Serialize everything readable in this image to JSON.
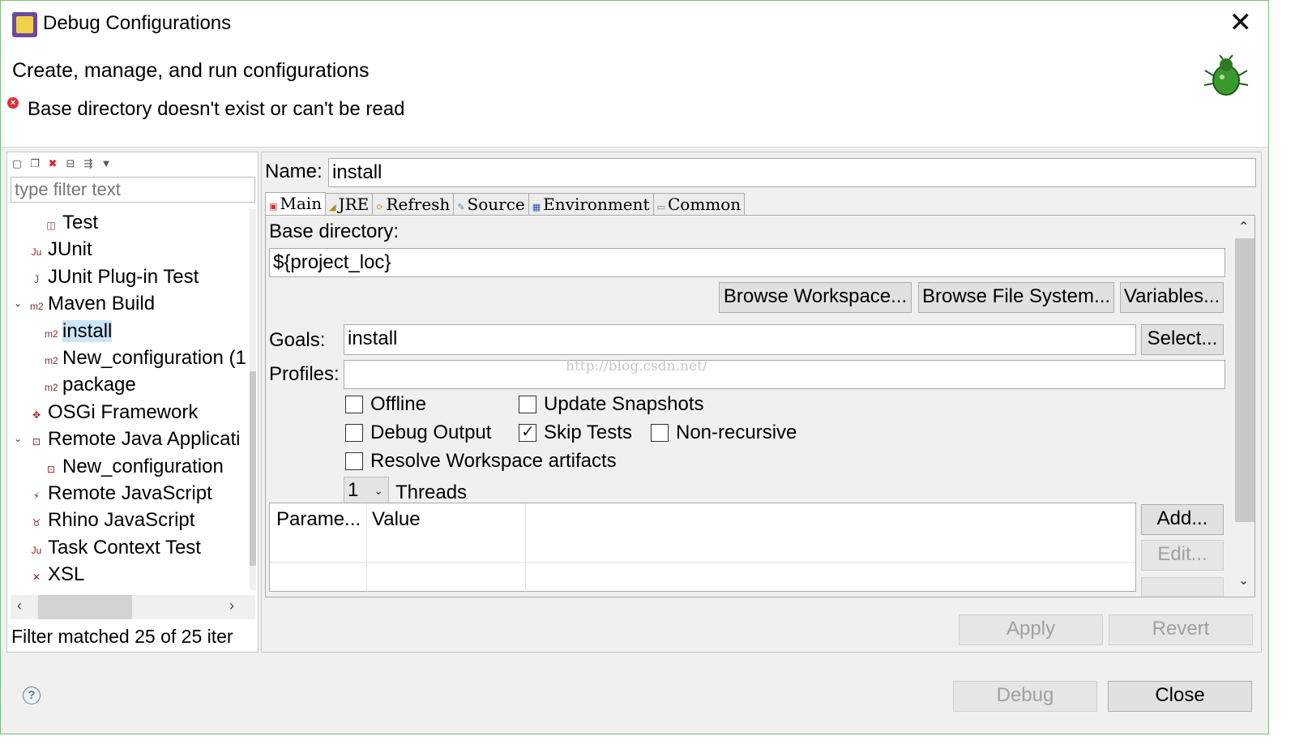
{
  "window": {
    "title": "Debug Configurations",
    "close_glyph": "✕"
  },
  "header": {
    "title": "Create, manage, and run configurations",
    "error_message": "Base directory doesn't exist or can't be read"
  },
  "left": {
    "filter_placeholder": "type filter text",
    "tree": [
      {
        "label": "Test",
        "icon": "test-icon",
        "level": 2
      },
      {
        "label": "JUnit",
        "icon": "junit-icon",
        "level": 1
      },
      {
        "label": "JUnit Plug-in Test",
        "icon": "junit-plugin-icon",
        "level": 1
      },
      {
        "label": "Maven Build",
        "icon": "maven-icon",
        "level": 1,
        "expanded": true
      },
      {
        "label": "install",
        "icon": "maven-icon",
        "level": 2,
        "selected": true
      },
      {
        "label": "New_configuration (1",
        "icon": "maven-icon",
        "level": 2
      },
      {
        "label": "package",
        "icon": "maven-icon",
        "level": 2
      },
      {
        "label": "OSGi Framework",
        "icon": "osgi-icon",
        "level": 1
      },
      {
        "label": "Remote Java Applicati",
        "icon": "remote-java-icon",
        "level": 1,
        "expanded": true
      },
      {
        "label": "New_configuration",
        "icon": "remote-java-icon",
        "level": 2
      },
      {
        "label": "Remote JavaScript",
        "icon": "remote-js-icon",
        "level": 1
      },
      {
        "label": "Rhino JavaScript",
        "icon": "rhino-icon",
        "level": 1
      },
      {
        "label": "Task Context Test",
        "icon": "task-context-icon",
        "level": 1
      },
      {
        "label": "XSL",
        "icon": "xsl-icon",
        "level": 1
      }
    ],
    "status": "Filter matched 25 of 25 iter"
  },
  "config": {
    "name_label": "Name:",
    "name_value": "install",
    "tabs": [
      "Main",
      "JRE",
      "Refresh",
      "Source",
      "Environment",
      "Common"
    ],
    "active_tab": "Main",
    "base_dir_label": "Base directory:",
    "base_dir_value": "${project_loc}",
    "browse_workspace": "Browse Workspace...",
    "browse_fs": "Browse File System...",
    "variables": "Variables...",
    "goals_label": "Goals:",
    "goals_value": "install",
    "select": "Select...",
    "profiles_label": "Profiles:",
    "profiles_value": "",
    "watermark": "http://blog.csdn.net/",
    "checkboxes": [
      {
        "label": "Offline",
        "checked": false
      },
      {
        "label": "Update Snapshots",
        "checked": false
      },
      {
        "label": "Debug Output",
        "checked": false
      },
      {
        "label": "Skip Tests",
        "checked": true
      },
      {
        "label": "Non-recursive",
        "checked": false
      },
      {
        "label": "Resolve Workspace artifacts",
        "checked": false
      }
    ],
    "threads_value": "1",
    "threads_label": "Threads",
    "table_headers": [
      "Parame...",
      "Value"
    ],
    "add": "Add...",
    "edit": "Edit...",
    "apply": "Apply",
    "revert": "Revert"
  },
  "footer": {
    "debug": "Debug",
    "close": "Close"
  }
}
